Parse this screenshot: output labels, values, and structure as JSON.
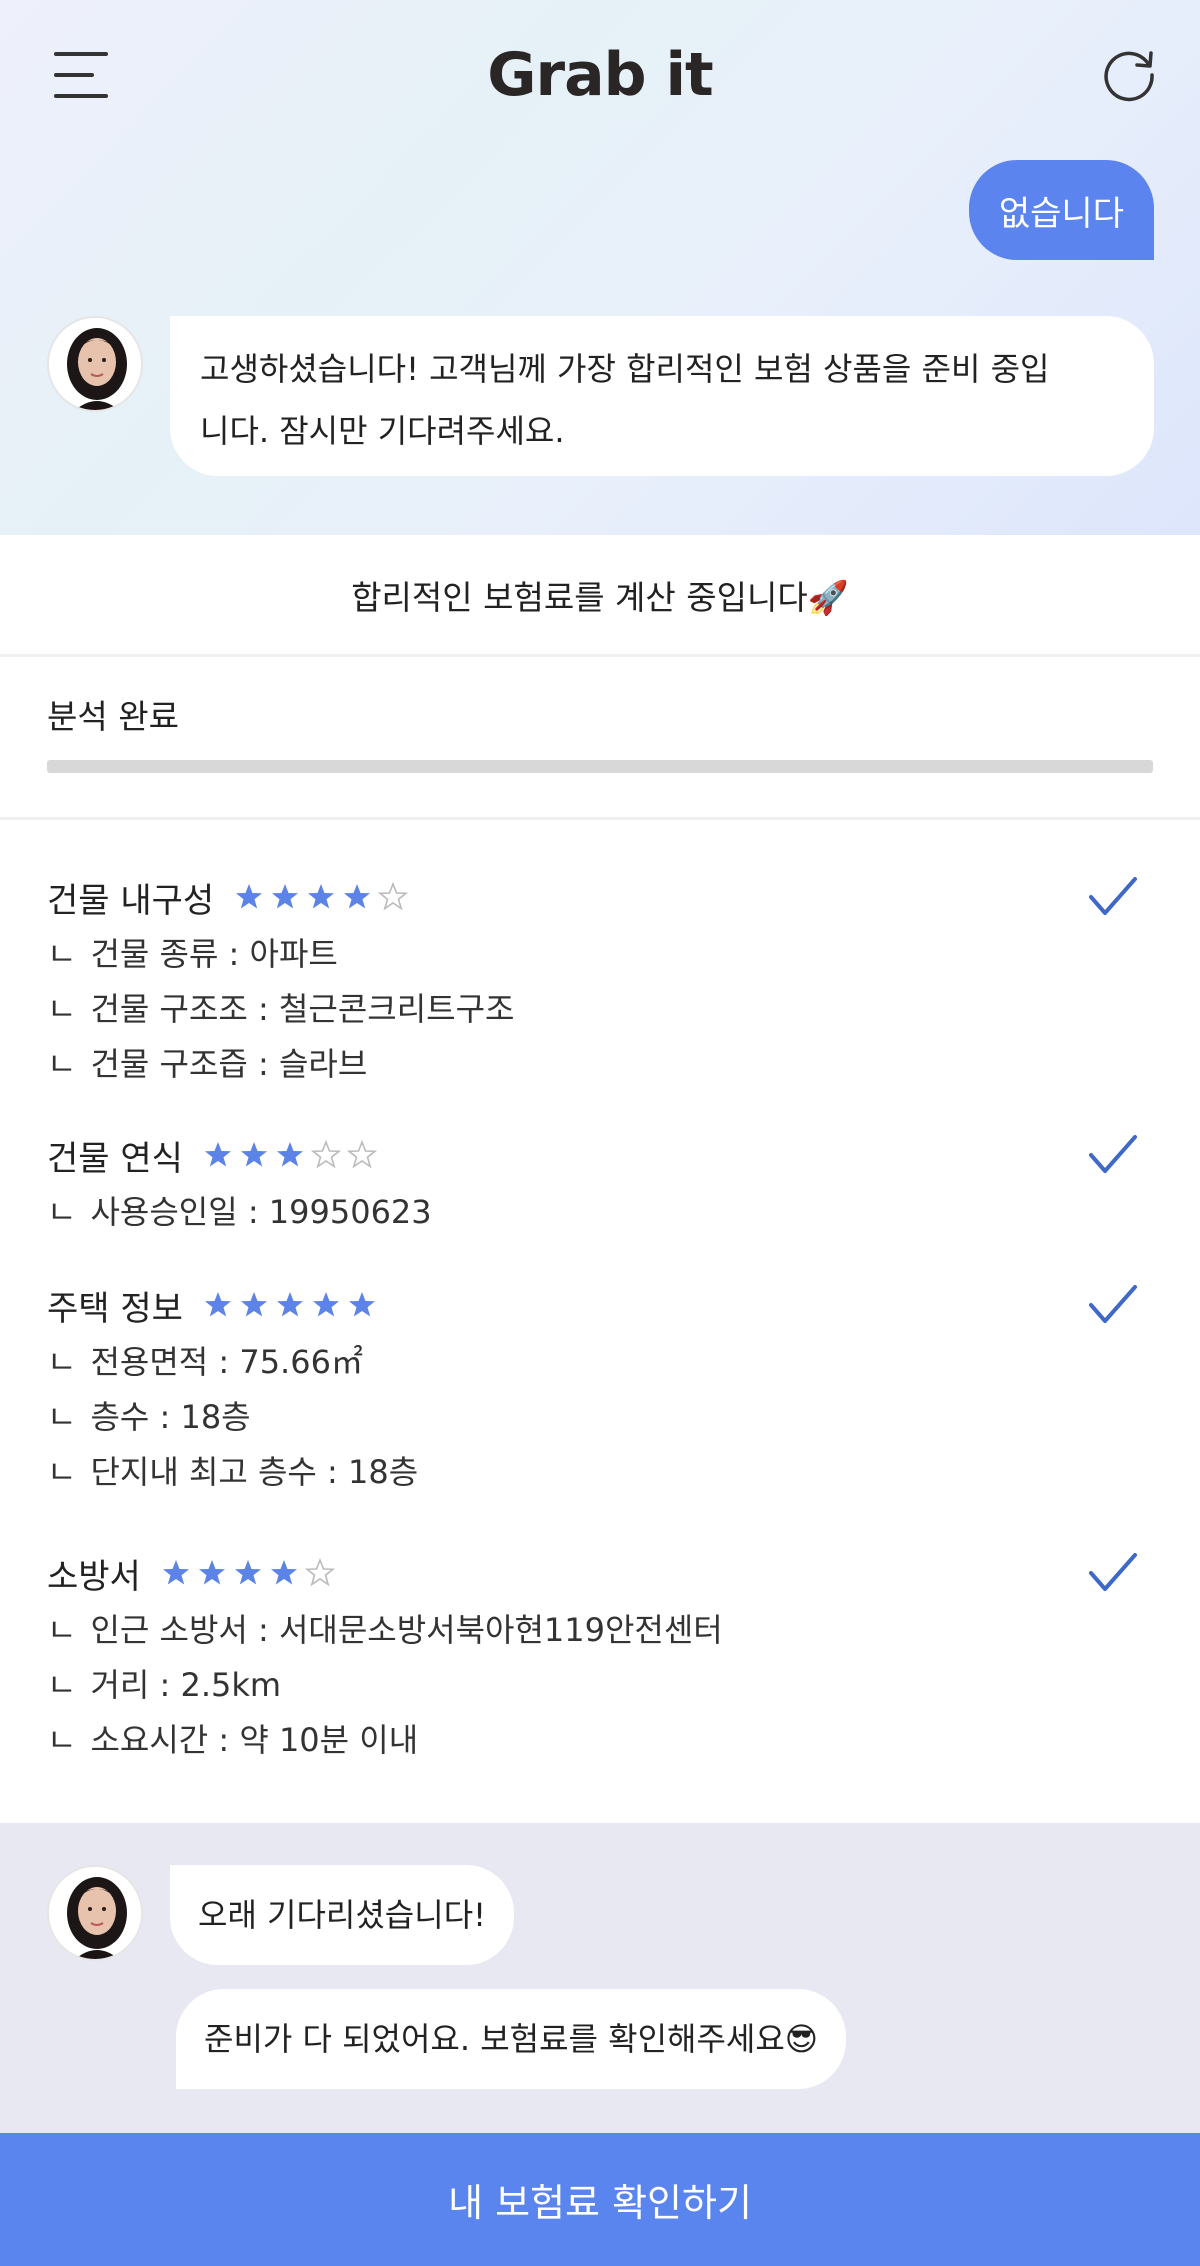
{
  "header": {
    "brand": "Grab it"
  },
  "chat_top": {
    "user_message": "없습니다",
    "bot_message_line1": "고생하셨습니다! 고객님께 가장 합리적인 보험 상품을 준비 중입",
    "bot_message_line2": "니다. 잠시만 기다려주세요."
  },
  "calculation": {
    "title": "합리적인 보험료를 계산 중입니다🚀",
    "status": "분석 완료",
    "progress_percent": 100
  },
  "categories": [
    {
      "title": "건물 내구성",
      "rating": 4,
      "max_rating": 5,
      "checked": true,
      "details": [
        {
          "prefix": "ㄴ",
          "text": "건물 종류 : 아파트"
        },
        {
          "prefix": "ㄴ",
          "text": "건물 구조조 : 철근콘크리트구조"
        },
        {
          "prefix": "ㄴ",
          "text": "건물 구조즙 : 슬라브"
        }
      ]
    },
    {
      "title": "건물 연식",
      "rating": 3,
      "max_rating": 5,
      "checked": true,
      "details": [
        {
          "prefix": "ㄴ",
          "text": "사용승인일 : 19950623"
        }
      ]
    },
    {
      "title": "주택 정보",
      "rating": 5,
      "max_rating": 5,
      "checked": true,
      "details": [
        {
          "prefix": "ㄴ",
          "text": "전용면적 : 75.66㎡"
        },
        {
          "prefix": "ㄴ",
          "text": "층수 : 18층"
        },
        {
          "prefix": "ㄴ",
          "text": "단지내 최고 층수 : 18층"
        }
      ]
    },
    {
      "title": "소방서",
      "rating": 4,
      "max_rating": 5,
      "checked": true,
      "details": [
        {
          "prefix": "ㄴ",
          "text": "인근 소방서 : 서대문소방서북아현119안전센터"
        },
        {
          "prefix": "ㄴ",
          "text": "거리 : 2.5km"
        },
        {
          "prefix": "ㄴ",
          "text": "소요시간 : 약 10분 이내"
        }
      ]
    }
  ],
  "chat_bottom": {
    "bot_message_1": "오래 기다리셨습니다!",
    "bot_message_2": "준비가 다 되었어요. 보험료를 확인해주세요😎"
  },
  "cta": {
    "label": "내 보험료 확인하기"
  },
  "colors": {
    "accent": "#5b85ee",
    "star_filled": "#5b84e6",
    "star_empty": "#bbbbbb",
    "check": "#3f69c9"
  }
}
